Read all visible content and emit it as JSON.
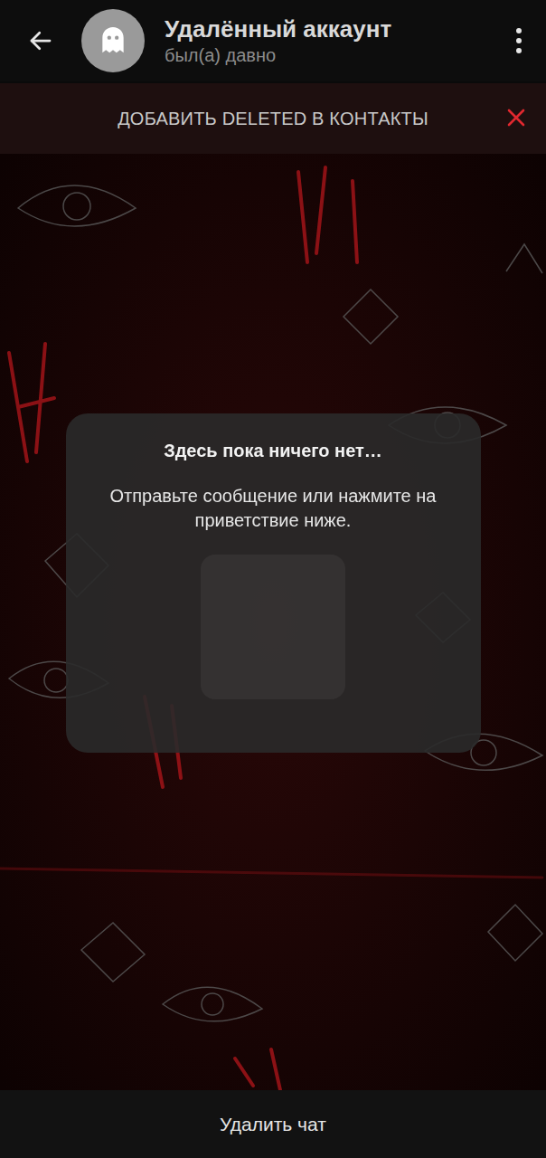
{
  "header": {
    "title": "Удалённый аккаунт",
    "status": "был(а) давно"
  },
  "banner": {
    "label": "ДОБАВИТЬ DELETED В КОНТАКТЫ"
  },
  "empty_state": {
    "title": "Здесь пока ничего нет…",
    "text": "Отправьте сообщение или нажмите на приветствие ниже."
  },
  "bottom_bar": {
    "label": "Удалить чат"
  }
}
